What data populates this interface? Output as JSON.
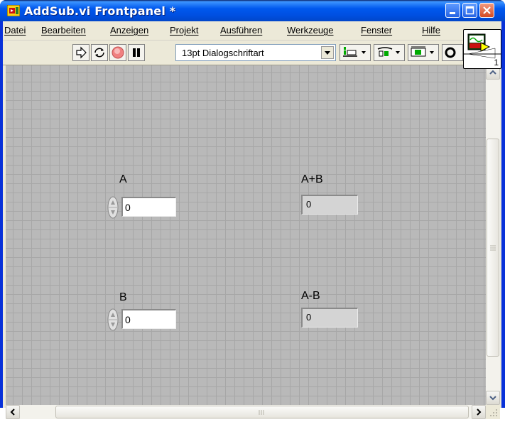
{
  "window": {
    "title": "AddSub.vi Frontpanel *"
  },
  "menu": {
    "items": [
      {
        "label": "Datei"
      },
      {
        "label": "Bearbeiten"
      },
      {
        "label": "Anzeigen"
      },
      {
        "label": "Projekt"
      },
      {
        "label": "Ausführen"
      },
      {
        "label": "Werkzeuge"
      },
      {
        "label": "Fenster"
      },
      {
        "label": "Hilfe"
      }
    ]
  },
  "toolbar": {
    "font_setting": "13pt Dialogschriftart",
    "connector_number": "1",
    "icons": [
      "run-arrow-icon",
      "run-continuous-icon",
      "abort-icon",
      "pause-icon",
      "align-objects-icon",
      "distribute-objects-icon",
      "resize-objects-icon",
      "reorder-icon"
    ]
  },
  "controls": {
    "a": {
      "label": "A",
      "value": "0"
    },
    "b": {
      "label": "B",
      "value": "0"
    }
  },
  "indicators": {
    "sum": {
      "label": "A+B",
      "value": "0"
    },
    "diff": {
      "label": "A-B",
      "value": "0"
    }
  },
  "colors": {
    "titlebar": "#0054e3",
    "panel_background": "#b9b9b9",
    "grid_lines": "#a7a7a7",
    "close_button": "#d34a22"
  }
}
